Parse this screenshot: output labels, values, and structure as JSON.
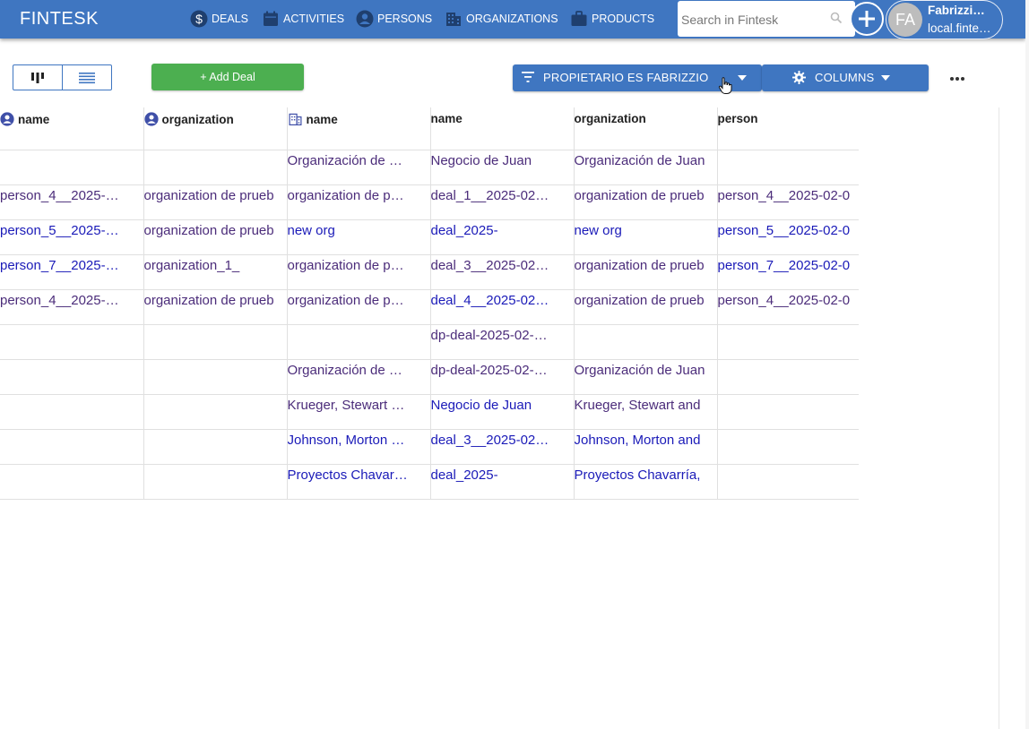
{
  "app": {
    "brand": "FINTESK"
  },
  "nav": [
    {
      "label": "DEALS",
      "icon": "dollar-icon"
    },
    {
      "label": "ACTIVITIES",
      "icon": "calendar-icon"
    },
    {
      "label": "PERSONS",
      "icon": "person-icon"
    },
    {
      "label": "ORGANIZATIONS",
      "icon": "building-icon"
    },
    {
      "label": "PRODUCTS",
      "icon": "briefcase-icon"
    }
  ],
  "search": {
    "placeholder": "Search in Fintesk",
    "value": ""
  },
  "user": {
    "initials": "FA",
    "name": "Fabrizzi…",
    "subtitle": "local.finte…"
  },
  "toolbar": {
    "add_deal_label": "+ Add Deal",
    "filter_label": "PROPIETARIO ES FABRIZZIO",
    "columns_label": "COLUMNS"
  },
  "colors": {
    "accent": "#3f76c1",
    "add": "#4caf50",
    "link_blue": "#1a1ab8",
    "link_purple": "#4b2c7a"
  },
  "table": {
    "headers": [
      {
        "label": "name",
        "icon": "person-icon"
      },
      {
        "label": "organization",
        "icon": "person-icon"
      },
      {
        "label": "name",
        "icon": "building-icon"
      },
      {
        "label": "name",
        "icon": ""
      },
      {
        "label": "organization",
        "icon": ""
      },
      {
        "label": "person",
        "icon": ""
      }
    ],
    "rows": [
      [
        "",
        "",
        "Organización de …",
        "Negocio de Juan",
        "Organización de Juan",
        ""
      ],
      [
        "person_4__2025-…",
        "organization de prueb",
        "organization de p…",
        "deal_1__2025-02…",
        "organization de prueb",
        "person_4__2025-02-0"
      ],
      [
        "person_5__2025-…",
        "organization de prueb",
        "new org",
        "deal_2025-",
        "new org",
        "person_5__2025-02-0"
      ],
      [
        "person_7__2025-…",
        "organization_1_",
        "organization de p…",
        "deal_3__2025-02…",
        "organization de prueb",
        "person_7__2025-02-0"
      ],
      [
        "person_4__2025-…",
        "organization de prueb",
        "organization de p…",
        "deal_4__2025-02…",
        "organization de prueb",
        "person_4__2025-02-0"
      ],
      [
        "",
        "",
        "",
        "dp-deal-2025-02-…",
        "",
        ""
      ],
      [
        "",
        "",
        "Organización de …",
        "dp-deal-2025-02-…",
        "Organización de Juan",
        ""
      ],
      [
        "",
        "",
        "Krueger, Stewart …",
        "Negocio de Juan",
        "Krueger, Stewart and",
        ""
      ],
      [
        "",
        "",
        "Johnson, Morton …",
        "deal_3__2025-02…",
        "Johnson, Morton and ",
        ""
      ],
      [
        "",
        "",
        "Proyectos Chavar…",
        "deal_2025-",
        "Proyectos Chavarría,",
        ""
      ]
    ],
    "row_colors": [
      [
        "",
        "",
        "purple",
        "purple",
        "purple",
        ""
      ],
      [
        "purple",
        "purple",
        "purple",
        "purple",
        "purple",
        "purple"
      ],
      [
        "blue",
        "purple",
        "blue",
        "blue",
        "blue",
        "blue"
      ],
      [
        "blue",
        "purple",
        "purple",
        "purple",
        "purple",
        "blue"
      ],
      [
        "purple",
        "purple",
        "purple",
        "blue",
        "purple",
        "purple"
      ],
      [
        "",
        "",
        "",
        "purple",
        "",
        ""
      ],
      [
        "",
        "",
        "purple",
        "purple",
        "purple",
        ""
      ],
      [
        "",
        "",
        "purple",
        "blue",
        "purple",
        ""
      ],
      [
        "",
        "",
        "blue",
        "blue",
        "blue",
        ""
      ],
      [
        "",
        "",
        "blue",
        "blue",
        "blue",
        ""
      ]
    ]
  }
}
